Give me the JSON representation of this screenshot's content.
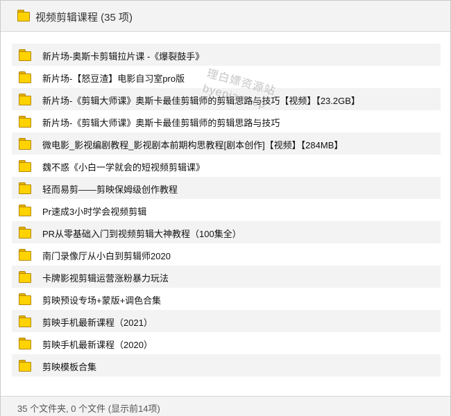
{
  "header": {
    "title": "视频剪辑课程 (35 项)",
    "icon": "folder-icon"
  },
  "items": [
    {
      "label": "新片场-奥斯卡剪辑拉片课 -《爆裂鼓手》"
    },
    {
      "label": "新片场-【怒豆渣】电影自习室pro版"
    },
    {
      "label": "新片场-《剪辑大师课》奥斯卡最佳剪辑师的剪辑思路与技巧【视频】【23.2GB】"
    },
    {
      "label": "新片场-《剪辑大师课》奥斯卡最佳剪辑师的剪辑思路与技巧"
    },
    {
      "label": "微电影_影视编剧教程_影视剧本前期构思教程[剧本创作]【视频】【284MB】"
    },
    {
      "label": "魏不惑《小白一学就会的短视频剪辑课》"
    },
    {
      "label": "轻而易剪——剪映保姆级创作教程"
    },
    {
      "label": "Pr速成3小时学会视频剪辑"
    },
    {
      "label": "PR从零基础入门到视频剪辑大神教程（100集全）"
    },
    {
      "label": "南门录像厅从小白到剪辑师2020"
    },
    {
      "label": "卡牌影视剪辑运营涨粉暴力玩法"
    },
    {
      "label": "剪映预设专场+蒙版+调色合集"
    },
    {
      "label": "剪映手机最新课程（2021）"
    },
    {
      "label": "剪映手机最新课程（2020）"
    },
    {
      "label": "剪映模板合集"
    }
  ],
  "watermark": {
    "line1": "理白嫖资源站",
    "line2": "byepiao.top"
  },
  "footer": {
    "status": "35 个文件夹, 0 个文件 (显示前14项)"
  },
  "colors": {
    "folder_fill": "#ffd200",
    "folder_border": "#b38600",
    "row_alt": "#f3f3f3"
  }
}
